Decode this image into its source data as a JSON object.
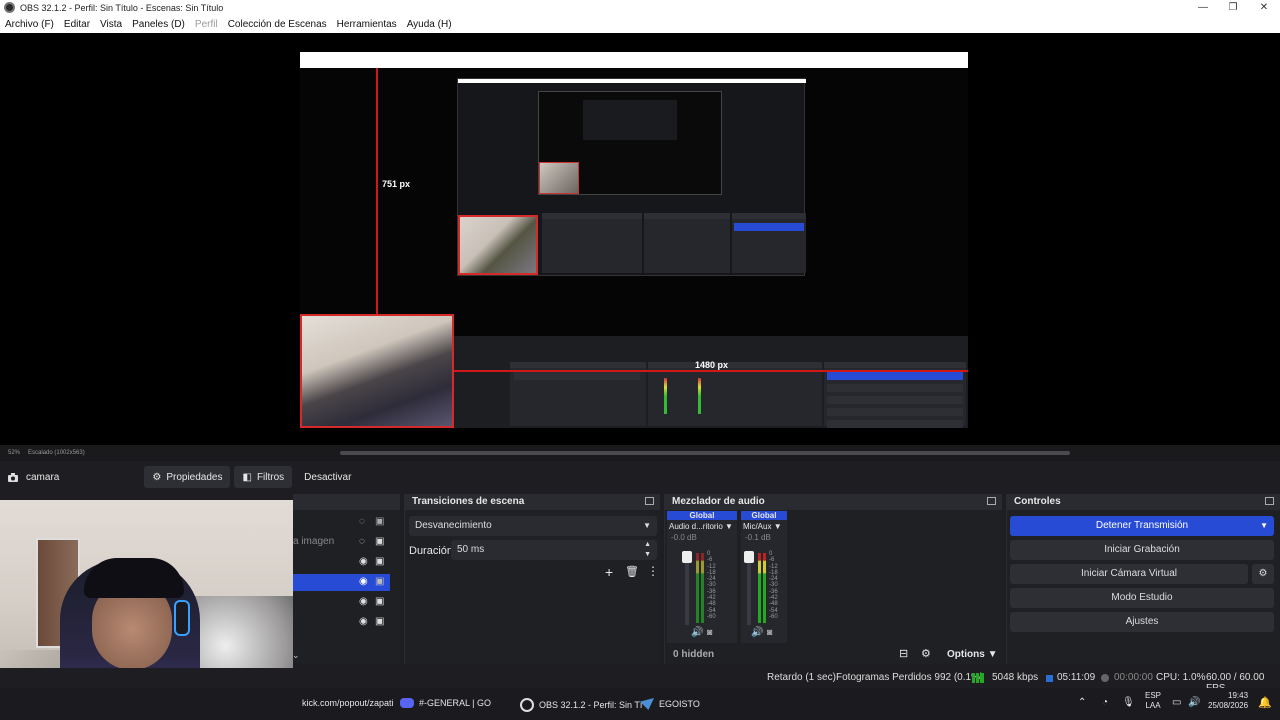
{
  "window": {
    "title": "OBS 32.1.2 - Perfil: Sin Título - Escenas: Sin Título",
    "minimize": "—",
    "maximize": "❐",
    "close": "✕"
  },
  "menu": {
    "archivo": "Archivo (F)",
    "editar": "Editar",
    "vista": "Vista",
    "paneles": "Paneles (D)",
    "perfil": "Perfil",
    "coleccion": "Colección de Escenas",
    "herramientas": "Herramientas",
    "ayuda": "Ayuda (H)"
  },
  "preview": {
    "label_vertical": "751 px",
    "label_horizontal": "1480 px",
    "zoom": "52%",
    "scale": "Escalado (1002x563)"
  },
  "source_toolbar": {
    "source_name": "camara",
    "propiedades": "Propiedades",
    "filtros": "Filtros",
    "desactivar": "Desactivar"
  },
  "scenes_dock": {
    "partial_item": "a imagen"
  },
  "transitions": {
    "title": "Transiciones de escena",
    "selected": "Desvanecimiento",
    "duration_label": "Duración",
    "duration_value": "50 ms"
  },
  "audio": {
    "title": "Mezclador de audio",
    "channels": [
      {
        "badge": "Global",
        "name": "Audio d...ritorio",
        "db": "-0.0 dB"
      },
      {
        "badge": "Global",
        "name": "Mic/Aux",
        "db": "-0.1 dB"
      }
    ],
    "scale_labels": [
      "0",
      "-6",
      "-12",
      "-18",
      "-24",
      "-30",
      "-36",
      "-42",
      "-48",
      "-54",
      "-60"
    ],
    "hidden": "0 hidden",
    "options": "Options"
  },
  "controls": {
    "title": "Controles",
    "stop_stream": "Detener Transmisión",
    "start_recording": "Iniciar Grabación",
    "virtual_cam": "Iniciar Cámara Virtual",
    "studio_mode": "Modo Estudio",
    "settings": "Ajustes"
  },
  "status": {
    "delay": "Retardo (1 sec)",
    "dropped": "Fotogramas Perdidos 992 (0.1%)",
    "bitrate": "5048 kbps",
    "stream_time": "05:11:09",
    "rec_time": "00:00:00",
    "cpu": "CPU: 1.0%",
    "fps": "60.00 / 60.00 FPS"
  },
  "taskbar": {
    "kick": "kick.com/popout/zapati",
    "discord": "#-GENERAL | GO",
    "obs": "OBS 32.1.2 - Perfil: Sin Tí",
    "steam": "EGOISTO",
    "lang1": "ESP",
    "lang2": "LAA",
    "time": "19:43",
    "date": "25/08/2026"
  }
}
